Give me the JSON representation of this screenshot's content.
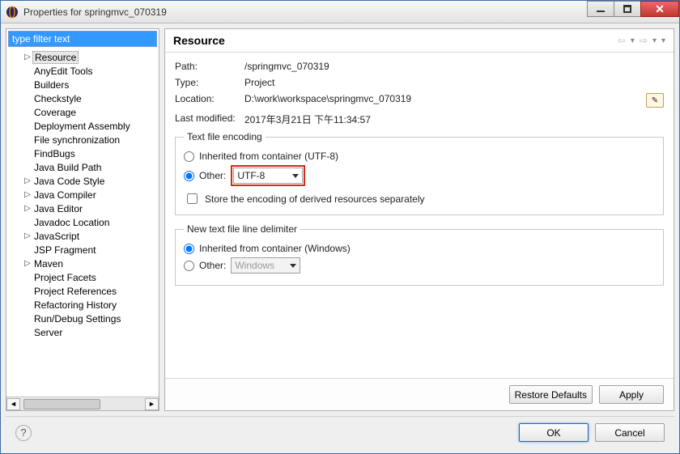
{
  "window": {
    "title": "Properties for springmvc_070319"
  },
  "sidebar": {
    "filter_value": "type filter text",
    "items": [
      {
        "label": "Resource",
        "expandable": true,
        "selected": true
      },
      {
        "label": "AnyEdit Tools",
        "expandable": false
      },
      {
        "label": "Builders",
        "expandable": false
      },
      {
        "label": "Checkstyle",
        "expandable": false
      },
      {
        "label": "Coverage",
        "expandable": false
      },
      {
        "label": "Deployment Assembly",
        "expandable": false
      },
      {
        "label": "File synchronization",
        "expandable": false
      },
      {
        "label": "FindBugs",
        "expandable": false
      },
      {
        "label": "Java Build Path",
        "expandable": false
      },
      {
        "label": "Java Code Style",
        "expandable": true
      },
      {
        "label": "Java Compiler",
        "expandable": true
      },
      {
        "label": "Java Editor",
        "expandable": true
      },
      {
        "label": "Javadoc Location",
        "expandable": false
      },
      {
        "label": "JavaScript",
        "expandable": true
      },
      {
        "label": "JSP Fragment",
        "expandable": false
      },
      {
        "label": "Maven",
        "expandable": true
      },
      {
        "label": "Project Facets",
        "expandable": false
      },
      {
        "label": "Project References",
        "expandable": false
      },
      {
        "label": "Refactoring History",
        "expandable": false
      },
      {
        "label": "Run/Debug Settings",
        "expandable": false
      },
      {
        "label": "Server",
        "expandable": false
      }
    ]
  },
  "main": {
    "heading": "Resource",
    "path_label": "Path:",
    "path_value": "/springmvc_070319",
    "type_label": "Type:",
    "type_value": "Project",
    "location_label": "Location:",
    "location_value": "D:\\work\\workspace\\springmvc_070319",
    "lastmod_label": "Last modified:",
    "lastmod_value": "2017年3月21日 下午11:34:57",
    "encoding_group": "Text file encoding",
    "encoding_inherited_label": "Inherited from container (UTF-8)",
    "encoding_other_label": "Other:",
    "encoding_other_value": "UTF-8",
    "encoding_store_label": "Store the encoding of derived resources separately",
    "delimiter_group": "New text file line delimiter",
    "delimiter_inherited_label": "Inherited from container (Windows)",
    "delimiter_other_label": "Other:",
    "delimiter_other_value": "Windows",
    "restore_btn": "Restore Defaults",
    "apply_btn": "Apply"
  },
  "footer": {
    "ok": "OK",
    "cancel": "Cancel"
  }
}
